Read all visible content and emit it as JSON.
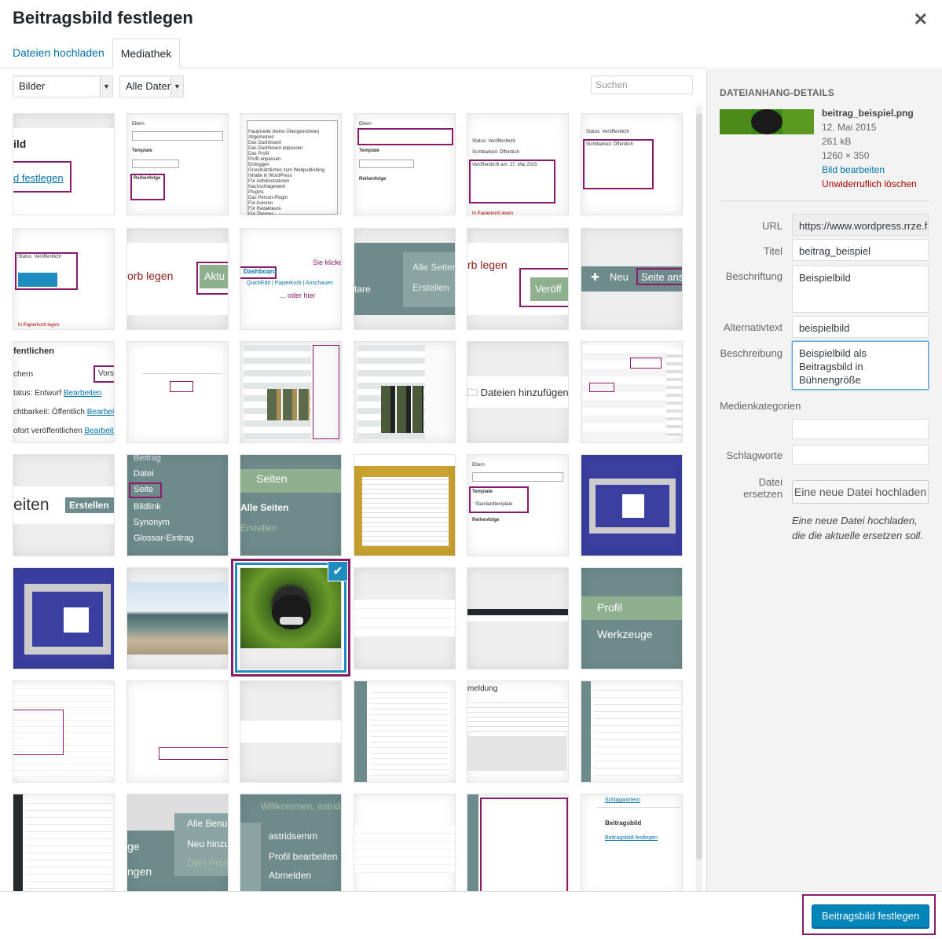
{
  "modal": {
    "title": "Beitragsbild festlegen",
    "close_icon": "close-icon"
  },
  "tabs": [
    {
      "label": "Dateien hochladen",
      "active": false
    },
    {
      "label": "Mediathek",
      "active": true
    }
  ],
  "filters": {
    "type_selected": "Bilder",
    "date_selected": "Alle Daten",
    "search_placeholder": "Suchen"
  },
  "grid": {
    "cells": [
      {
        "kind": "screenshot",
        "text": "ild",
        "link": "d festlegen"
      },
      {
        "kind": "screenshot",
        "text": "Eltern / Seiten / Template / Reihenfolge"
      },
      {
        "kind": "screenshot",
        "text": "Hauptseite (keine Übergeordnete)"
      },
      {
        "kind": "screenshot",
        "text": "Eltern / Seiten / Template / Reihenfolge"
      },
      {
        "kind": "screenshot",
        "text": "Veröffentlicht am: 27. Mai 2015"
      },
      {
        "kind": "screenshot",
        "text": "Sichtbarkeit: Öffentlich"
      },
      {
        "kind": "screenshot",
        "text": "Status: Veröffentlicht"
      },
      {
        "kind": "screenshot",
        "text": "orb legen",
        "btn": "Aktu"
      },
      {
        "kind": "screenshot",
        "text": "Dashboard",
        "note1": "Sie klicke",
        "note2": "... oder hier"
      },
      {
        "kind": "screenshot",
        "text": "tare",
        "btn": "Alle Seiten",
        "btn2": "Erstellen"
      },
      {
        "kind": "screenshot",
        "text": "rb legen",
        "btn": "Veröff"
      },
      {
        "kind": "screenshot",
        "text": "Neu",
        "btn": "Seite ans"
      },
      {
        "kind": "screenshot",
        "text": "fentlichen",
        "l2": "chern",
        "l3": "tatus: Entwurf",
        "l3link": "Bearbeiten",
        "l4": "chtbarkeit: Öffentlich",
        "l4link": "Bearbeiten",
        "l5": "ofort veröffentlichen",
        "l5link": "Bearbeiten",
        "btn": "Vors"
      },
      {
        "kind": "screenshot",
        "text": ""
      },
      {
        "kind": "screenshot",
        "text": ""
      },
      {
        "kind": "screenshot",
        "text": ""
      },
      {
        "kind": "screenshot",
        "text": "Dateien hinzufügen"
      },
      {
        "kind": "screenshot",
        "text": ""
      },
      {
        "kind": "screenshot",
        "text": "eiten",
        "btn": "Erstellen"
      },
      {
        "kind": "screenshot",
        "items": [
          "Beitrag",
          "Datei",
          "Seite",
          "Bildlink",
          "Synonym",
          "Glossar-Eintrag"
        ]
      },
      {
        "kind": "screenshot",
        "text": "Seiten",
        "l2": "Alle Seiten",
        "l3": "Erstellen"
      },
      {
        "kind": "screenshot",
        "text": ""
      },
      {
        "kind": "screenshot",
        "text": "Eltern / Template / Reihenfolge",
        "l2": "Standardtemplate"
      },
      {
        "kind": "pattern-blue"
      },
      {
        "kind": "pattern-blue2"
      },
      {
        "kind": "photo-sea"
      },
      {
        "kind": "photo-monkey",
        "selected": true
      },
      {
        "kind": "screenshot",
        "text": ""
      },
      {
        "kind": "screenshot",
        "text": ""
      },
      {
        "kind": "screenshot",
        "text": "Profil",
        "l2": "Werkzeuge"
      },
      {
        "kind": "screenshot",
        "text": ""
      },
      {
        "kind": "screenshot",
        "text": ""
      },
      {
        "kind": "screenshot",
        "text": ""
      },
      {
        "kind": "screenshot",
        "text": ""
      },
      {
        "kind": "screenshot",
        "text": "meldung"
      },
      {
        "kind": "screenshot",
        "text": ""
      },
      {
        "kind": "screenshot",
        "text": ""
      },
      {
        "kind": "screenshot",
        "text": "Alle Benu",
        "l2": "Neu hinzu",
        "l3": "Dein Profi",
        "l4": "ge",
        "l5": "ngen"
      },
      {
        "kind": "screenshot",
        "text": "Willkommen, astrids",
        "l2": "astridsemm",
        "l3": "Profil bearbeiten",
        "l4": "Abmelden"
      },
      {
        "kind": "screenshot",
        "text": ""
      },
      {
        "kind": "screenshot",
        "text": ""
      },
      {
        "kind": "screenshot",
        "text": "Schlagwörtern",
        "l2": "Beitragsbild",
        "l3": "Beitragsbild festlegen"
      }
    ]
  },
  "details": {
    "heading": "DATEIANHANG-DETAILS",
    "filename": "beitrag_beispiel.png",
    "date": "12. Mai 2015",
    "size": "261 kB",
    "dimensions": "1260 × 350",
    "edit_link": "Bild bearbeiten",
    "delete_link": "Unwiderruflich löschen",
    "fields": {
      "url_label": "URL",
      "url_value": "https://www.wordpress.rrze.fa",
      "title_label": "Titel",
      "title_value": "beitrag_beispiel",
      "caption_label": "Beschriftung",
      "caption_value": "Beispielbild",
      "alt_label": "Alternativtext",
      "alt_value": "beispielbild",
      "desc_label": "Beschreibung",
      "desc_value": "Beispielbild als Beitragsbild in Bühnengröße",
      "mediacat_label": "Medienkategorien",
      "mediacat_value": "",
      "tags_label": "Schlagworte",
      "tags_value": "",
      "replace_label": "Datei ersetzen",
      "replace_button": "Eine neue Datei hochladen",
      "replace_note": "Eine neue Datei hochladen, die die aktuelle ersetzen soll."
    }
  },
  "footer": {
    "primary_button": "Beitragsbild festlegen"
  },
  "colors": {
    "primary": "#0085ba",
    "link": "#0073aa",
    "highlight": "#8b1a6b",
    "selected": "#1e8cbe"
  }
}
